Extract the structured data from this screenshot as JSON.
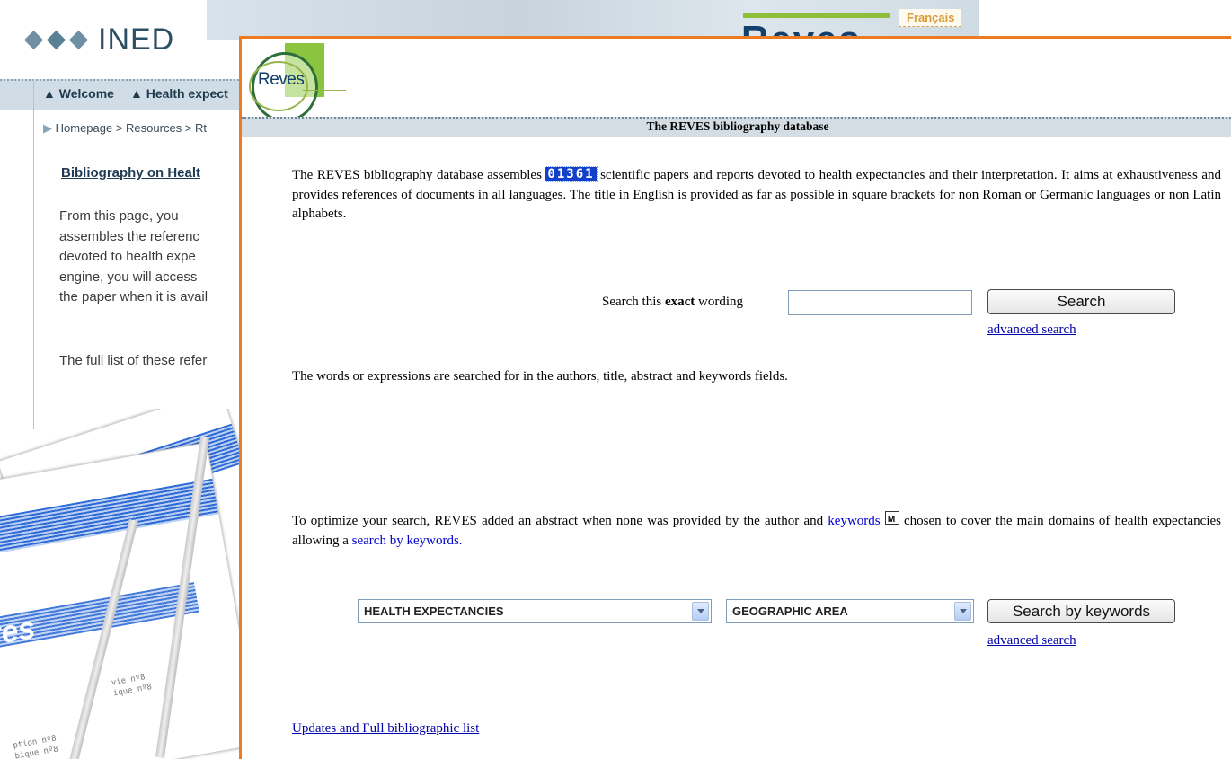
{
  "background": {
    "logo_text": "INED",
    "language_link": "Français",
    "nav": [
      "Welcome",
      "Health expect"
    ],
    "breadcrumb": "Homepage > Resources > Rt",
    "heading": "Bibliography on Healt",
    "paragraph_lines": [
      "From this page, you",
      "assembles the referenc",
      "devoted to health expe",
      "engine, you will access",
      "the paper when it is avail"
    ],
    "paragraph2": "The full list of these refer",
    "reves_logo_text": "Reves",
    "collage_text": [
      "ves",
      "vie nº8",
      "ique nº8",
      "ption nº8",
      "bique nº8"
    ]
  },
  "popup": {
    "logo_text": "Reves",
    "title": "The REVES bibliography database",
    "intro": {
      "before": "The REVES bibliography database assembles ",
      "counter": "01361",
      "after": " scientific papers and reports devoted to health expectancies and their interpretation. It aims at exhaustiveness and provides references of documents in all languages. The title in English is provided as far as possible in square brackets for non Roman or Germanic languages or non Latin alphabets."
    },
    "search": {
      "label_pre": "Search this ",
      "label_bold": "exact",
      "label_post": " wording",
      "input_value": "",
      "button_label": "Search",
      "advanced_link": "advanced search"
    },
    "words_text": "The words or expressions are searched for in the authors, title, abstract and keywords fields.",
    "optimize": {
      "before": "To optimize your search, REVES added an abstract when none was provided by the author and ",
      "keywords_link": "keywords",
      "middle": " chosen to cover the main domains of health expectancies allowing a ",
      "search_by_keywords_link": "search by keywords."
    },
    "keyword_search": {
      "select1_value": "HEALTH EXPECTANCIES",
      "select2_value": "GEOGRAPHIC AREA",
      "button_label": "Search by keywords",
      "advanced_link": "advanced search"
    },
    "updates_link": "Updates and Full bibliographic list"
  },
  "colors": {
    "popup_border": "#ee7a22",
    "header_bar": "#d3dde3",
    "counter_bg": "#1340c9",
    "link": "#0000aa"
  },
  "icons": [
    "dropdown-arrow-icon",
    "keywords-document-icon"
  ]
}
